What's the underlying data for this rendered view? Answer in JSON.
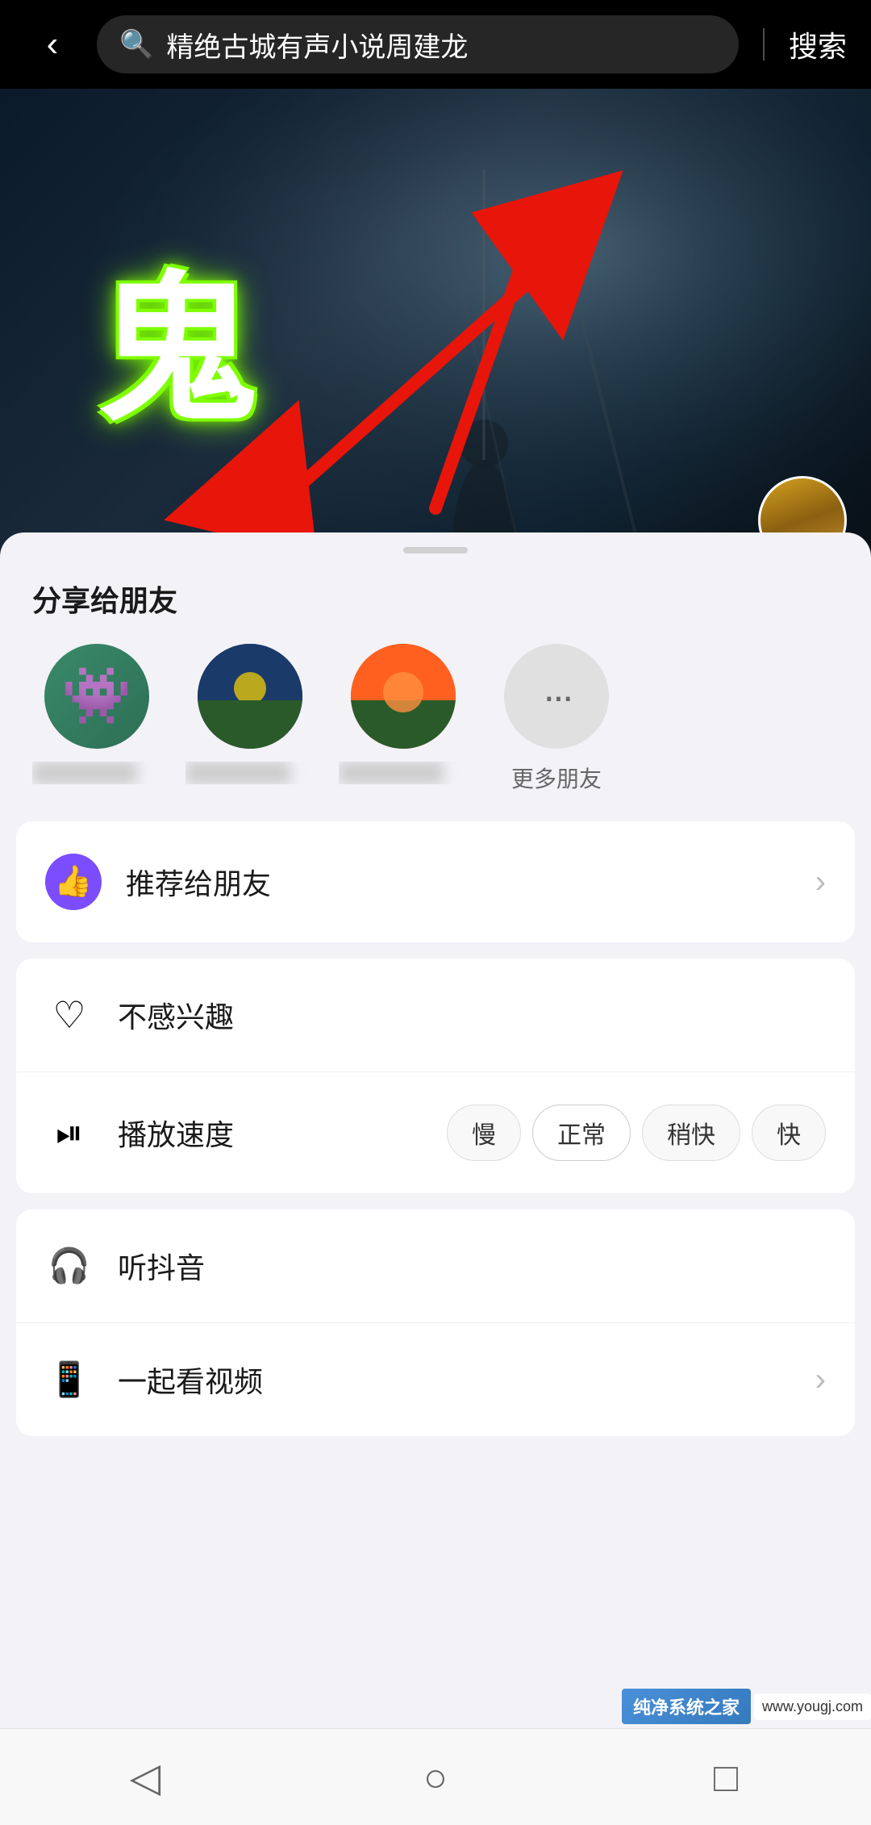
{
  "header": {
    "back_label": "‹",
    "search_placeholder": "精绝古城有声小说周建龙",
    "search_button": "搜索",
    "search_icon": "🔍"
  },
  "video": {
    "ghost_char": "鬼",
    "bg_color": "#0a1a2a"
  },
  "sheet": {
    "handle_visible": true,
    "share_title": "分享给朋友",
    "more_label": "更多朋友",
    "more_icon": "···",
    "friends": [
      {
        "id": 1,
        "type": "monster",
        "name_hidden": true
      },
      {
        "id": 2,
        "type": "landscape1",
        "name_hidden": true
      },
      {
        "id": 3,
        "type": "landscape2",
        "name_hidden": true
      },
      {
        "id": 4,
        "type": "more",
        "name_hidden": false
      }
    ]
  },
  "menu": {
    "recommend": {
      "icon": "👍",
      "label": "推荐给朋友",
      "has_chevron": true
    },
    "not_interested": {
      "icon": "♡",
      "label": "不感兴趣",
      "has_chevron": false
    },
    "playback_speed": {
      "icon": "⏯",
      "label": "播放速度",
      "options": [
        "慢",
        "正常",
        "稍快",
        "快"
      ],
      "active_option": "正常"
    },
    "listen_douyin": {
      "icon": "🎧",
      "label": "听抖音",
      "has_chevron": false
    },
    "watch_together": {
      "icon": "📱",
      "label": "一起看视频",
      "has_chevron": true
    }
  },
  "navbar": {
    "back": "◁",
    "home": "○",
    "recent": "□"
  },
  "watermark": {
    "line1": "纯净系统之家",
    "line2": "www.yougj.com"
  },
  "annotations": {
    "arrow_up_text": "↑ upward red arrow pointing at avatar",
    "arrow_down_text": "↓ downward red arrow pointing at 听抖音"
  }
}
